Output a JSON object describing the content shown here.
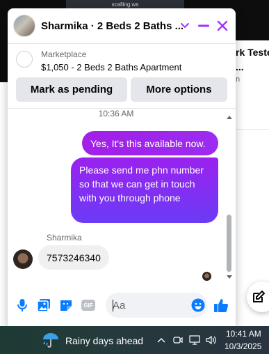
{
  "background": {
    "top_tab_text": "scalling.ws",
    "right_card": {
      "title_line1": "rk Teste",
      "title_line2": "...",
      "subtitle": "n"
    }
  },
  "chat": {
    "title": "Sharmika · 2 Beds 2 Baths ...",
    "header_icons": [
      "chevron-down-icon",
      "minimize-icon",
      "close-icon"
    ],
    "accent_color": "#a033ff",
    "marketplace": {
      "label": "Marketplace",
      "listing": "$1,050 - 2 Beds 2 Baths Apartment"
    },
    "actions": {
      "mark_pending": "Mark as pending",
      "more_options": "More options"
    },
    "timestamp": "10:36 AM",
    "messages": [
      {
        "from": "me",
        "text": "Yes, It's this available now."
      },
      {
        "from": "me",
        "text": "Please send me  phn number so that we can get in touch with you through phone"
      },
      {
        "from": "Sharmika",
        "text": "7573246340"
      }
    ],
    "sender_name": "Sharmika",
    "composer": {
      "placeholder": "Aa",
      "icons": [
        "microphone-icon",
        "photo-icon",
        "sticker-icon",
        "gif-icon",
        "emoji-icon",
        "thumbs-up-icon"
      ],
      "gif_label": "GIF"
    }
  },
  "taskbar": {
    "weather": "Rainy days ahead",
    "time": "10:41 AM",
    "date": "10/3/2025"
  }
}
